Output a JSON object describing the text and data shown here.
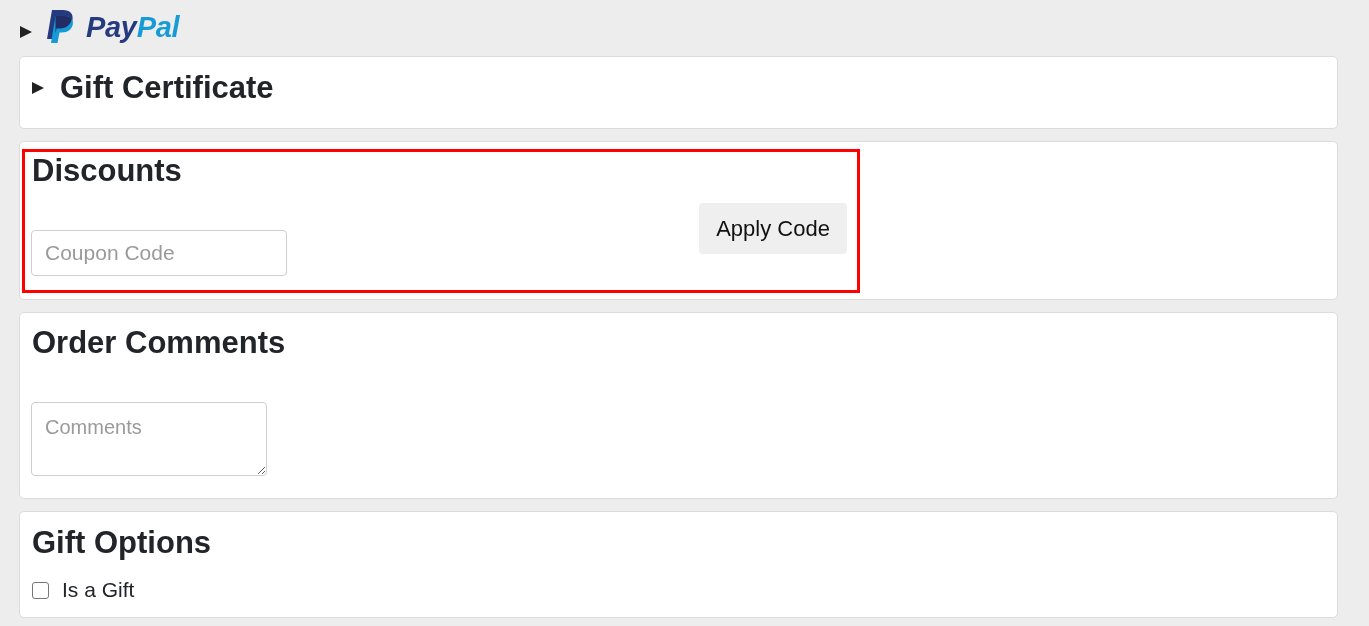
{
  "paypal_option": {
    "expanded": false,
    "wordmark": "PayPal"
  },
  "sections": [
    {
      "kind": "collapsible",
      "title": "Gift Certificate",
      "expanded": false
    },
    {
      "kind": "coupon",
      "title": "Discounts",
      "highlighted": true,
      "field": {
        "placeholder": "Coupon Code"
      },
      "button": "Apply Code"
    },
    {
      "kind": "comments",
      "title": "Order Comments",
      "field": {
        "placeholder": "Comments"
      }
    },
    {
      "kind": "checkbox",
      "title": "Gift Options",
      "option": {
        "label": "Is a Gift",
        "checked": false
      }
    }
  ]
}
